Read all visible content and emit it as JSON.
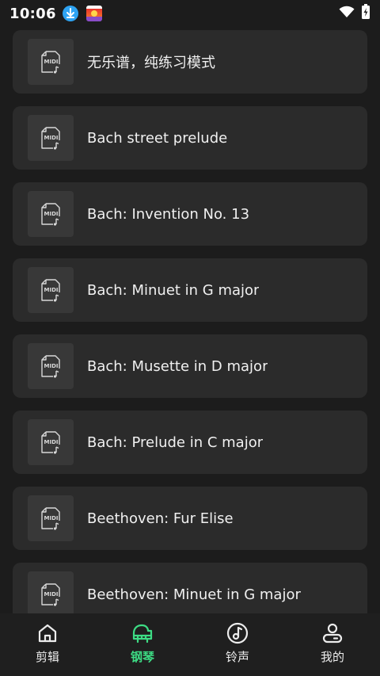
{
  "status_bar": {
    "time": "10:06"
  },
  "songs": [
    {
      "title": "无乐谱，纯练习模式"
    },
    {
      "title": "Bach street prelude"
    },
    {
      "title": "Bach: Invention No. 13"
    },
    {
      "title": "Bach: Minuet in G major"
    },
    {
      "title": "Bach: Musette in D major"
    },
    {
      "title": "Bach: Prelude in C major"
    },
    {
      "title": "Beethoven: Fur Elise"
    },
    {
      "title": "Beethoven: Minuet in G major"
    }
  ],
  "tabs": [
    {
      "label": "剪辑",
      "icon": "home-icon",
      "active": false
    },
    {
      "label": "钢琴",
      "icon": "piano-icon",
      "active": true
    },
    {
      "label": "铃声",
      "icon": "music-note-icon",
      "active": false
    },
    {
      "label": "我的",
      "icon": "profile-icon",
      "active": false
    }
  ],
  "colors": {
    "background": "#1c1c1c",
    "card": "#2b2b2b",
    "icon_box": "#383838",
    "accent": "#3ddc84"
  }
}
